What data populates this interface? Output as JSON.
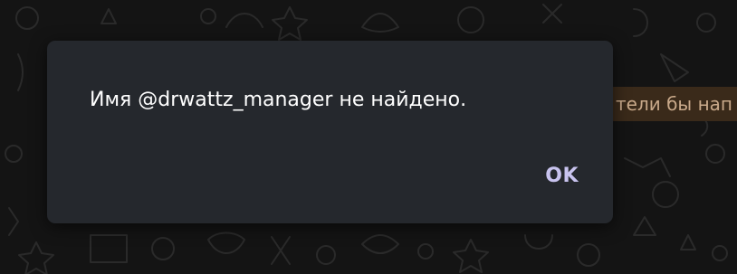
{
  "background": {
    "message_text": "тели бы нап",
    "message_bubble_color": "#3a2a1a",
    "chat_background_color": "#141414"
  },
  "dialog": {
    "message": "Имя @drwattz_manager не найдено.",
    "ok_label": "OK",
    "accent_color": "#c8c3ee",
    "surface_color": "#25282d"
  }
}
